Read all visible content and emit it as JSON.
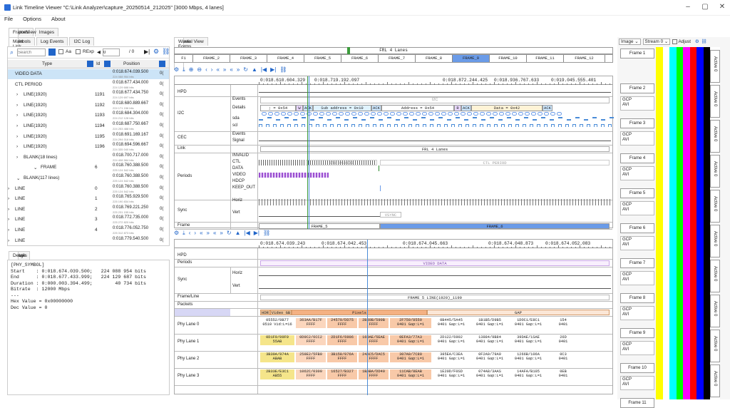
{
  "window": {
    "title": "Link Timeline Viewer \"C:\\Link Analyzer\\capture_20250514_212025\" [3000 Mbps, 4 lanes]",
    "minimize": "–",
    "maximize": "▢",
    "close": "✕"
  },
  "menu": [
    "File",
    "Options",
    "About"
  ],
  "top_tabs": [
    "FrameView",
    "Reports",
    "Images"
  ],
  "sub_tabs": [
    "Main Link Events",
    "Symbols",
    "Log Events",
    "I2C Log"
  ],
  "search": {
    "placeholder": "Search",
    "aa_label": "Aa",
    "rexp_label": "RExp",
    "index_value": "0",
    "index_total": "/ 0"
  },
  "table": {
    "headers": [
      "Type",
      "Id",
      "Position"
    ],
    "rows": [
      {
        "indent": 2,
        "type": "VIDEO DATA",
        "id": "",
        "pos": "0:018.674.039.500",
        "pos2": "224 088 954 bits",
        "ox": "0(",
        "sel": true
      },
      {
        "indent": 2,
        "type": "CTL PERIOD",
        "id": "",
        "pos": "0:018.677.434.000",
        "pos2": "224 129 688 bits",
        "ox": "0(",
        "sel": false
      },
      {
        "indent": 1,
        "type": "LINE(1920)",
        "id": "1191",
        "pos": "0:018.677.434.750",
        "pos2": "224 129 697 bits",
        "ox": "0(",
        "sel": false
      },
      {
        "indent": 1,
        "type": "LINE(1920)",
        "id": "1192",
        "pos": "0:018.680.889.667",
        "pos2": "224 171 156 bits",
        "ox": "0(",
        "sel": false
      },
      {
        "indent": 1,
        "type": "LINE(1920)",
        "id": "1193",
        "pos": "0:018.684.304.000",
        "pos2": "224 212 128 bits",
        "ox": "0(",
        "sel": false
      },
      {
        "indent": 1,
        "type": "LINE(1920)",
        "id": "1194",
        "pos": "0:018.687.750.667",
        "pos2": "224 253 488 bits",
        "ox": "0(",
        "sel": false
      },
      {
        "indent": 1,
        "type": "LINE(1920)",
        "id": "1195",
        "pos": "0:018.691.169.167",
        "pos2": "224 294 016 bits",
        "ox": "0(",
        "sel": false
      },
      {
        "indent": 1,
        "type": "LINE(1920)",
        "id": "1196",
        "pos": "0:018.694.596.667",
        "pos2": "224 335 040 bits",
        "ox": "0(",
        "sel": false
      },
      {
        "indent": 1,
        "type": "BLANK(18 lines)",
        "id": "",
        "pos": "0:018.700.717.000",
        "pos2": "224 408 584 bits",
        "ox": "0(",
        "sel": false
      },
      {
        "indent": 0,
        "type": "FRAME",
        "id": "6",
        "pos": "0:018.760.388.500",
        "pos2": "225 124 542 bits",
        "ox": "0(",
        "sel": false
      },
      {
        "indent": 1,
        "type": "BLANK(117 lines)",
        "id": "",
        "pos": "0:018.760.388.500",
        "pos2": "225 124 542 bits",
        "ox": "0(",
        "sel": false
      },
      {
        "indent": 2,
        "type": "LINE",
        "id": "0",
        "pos": "0:018.760.388.500",
        "pos2": "225 124 542 bits",
        "ox": "0(",
        "sel": false
      },
      {
        "indent": 2,
        "type": "LINE",
        "id": "1",
        "pos": "0:018.765.929.500",
        "pos2": "225 190 834 bits",
        "ox": "0(",
        "sel": false
      },
      {
        "indent": 2,
        "type": "LINE",
        "id": "2",
        "pos": "0:018.769.221.250",
        "pos2": "225 231 155 bits",
        "ox": "0(",
        "sel": false
      },
      {
        "indent": 2,
        "type": "LINE",
        "id": "3",
        "pos": "0:018.772.735.000",
        "pos2": "225 272 820 bits",
        "ox": "0(",
        "sel": false
      },
      {
        "indent": 2,
        "type": "LINE",
        "id": "4",
        "pos": "0:018.776.052.750",
        "pos2": "225 312 873 bits",
        "ox": "0(",
        "sel": false
      },
      {
        "indent": 2,
        "type": "LINE",
        "id": "",
        "pos": "0:018.779.540.500",
        "pos2": "",
        "ox": "0(",
        "sel": false
      }
    ]
  },
  "detail_tabs": [
    "Details",
    "Image"
  ],
  "details": "[PHY_SYMBOL]\nStart    : 0:018.674.039.500;   224 088 954 bits\nEnd      : 0:018.677.433.999;   224 129 687 bits\nDuration : 0:000.003.394.499;        40 734 bits\nBitrate  : 12000 Mbps\n---\nHex Value = 0x00000000\nDec Value = 0",
  "main_tabs": [
    "Wave Forms",
    "Spatial View"
  ],
  "frl_label": "FRL 4 Lanes",
  "frames": [
    "F1",
    "FRAME_2",
    "FRAME_3",
    "FRAME_4",
    "FRAME_5",
    "FRAME_6",
    "FRAME_7",
    "FRAME_8",
    "FRAME_9",
    "FRAME_10",
    "FRAME_11",
    "FRAME_12"
  ],
  "wf1": {
    "timestamps": [
      "0:018.610.604.329",
      "0:018.719.192.097",
      "0:018.872.244.425",
      "0:018.936.767.633",
      "0:019.045.555.401"
    ],
    "rows": [
      "HPD",
      "I2C",
      "CEC",
      "Link",
      "Periods",
      "Sync",
      "Frame"
    ],
    "subrows": [
      "Events",
      "Details",
      "sda",
      "scl",
      "Events",
      "Signal",
      "INVALID",
      "CTL",
      "DATA",
      "VIDEO",
      "HDCP",
      "KEEP_OUT",
      "Horiz",
      "Vert"
    ],
    "i2c_events": "I2C",
    "i2c_details": [
      "; = 0x54",
      "W",
      "ACK",
      "Sub address = 0x10",
      "ACK",
      "Address = 0x54",
      "R",
      "ACK",
      "Data = 0x42",
      "ACK"
    ],
    "link_label": "FRL 4 Lanes",
    "ctl_period_labels": [
      "CTL PERIOD",
      "CTL PERIOD"
    ],
    "vsync_label": "VSYNC",
    "frame_labels": [
      "FRAME_5",
      "FRAME_6"
    ]
  },
  "wf2": {
    "timestamps": [
      "0:018.674.039.243",
      "0:018.674.042.453",
      "0:018.674.045.663",
      "0:018.674.048.873",
      "0:018.674.052.083"
    ],
    "rows": [
      "HPD",
      "Periods",
      "Sync",
      "Frame/Line",
      "Packets",
      "Symbols",
      "Phy Lane 0",
      "Phy Lane 1",
      "Phy Lane 2",
      "Phy Lane 3"
    ],
    "subrows": [
      "Horiz",
      "Vert"
    ],
    "video_data": "VIDEO DATA",
    "frame_line": "FRAME 5 LINE(1920)_1190",
    "symbols": [
      "HDR",
      "Video GB",
      "Pixels",
      "GAP"
    ],
    "lanes": [
      [
        "05552/0B77\n0510 Vid:L=16",
        "363AA/B17F\nFFFF",
        "24570/DD75\nFFFF",
        "2B30B/590B\nFFFF",
        "2F759/8559\n0401 Gap:L=1",
        "0B445/5A45\n0401 Gap:L=1",
        "1B1B5/D9B5\n0401 Gap:L=1",
        "1DOC1/E8C1\n0401 Gap:L=1",
        "154\n0401"
      ],
      [
        "0D1F9/09F9\n55AB",
        "0D9C2/6CC2\nFFFF",
        "2D1F6/6906\nFFFF",
        "160AE/5EAE\nFFFF",
        "0EFA3/77A3\n0401 Gap:L=1",
        "2D122/6902\n0401 Gap:L=1",
        "13884/9B84\n0401 Gap:L=1",
        "39DAE/1SAE\n0401 Gap:L=1",
        "26D\n0401"
      ],
      [
        "3B30A/874A\nABAB",
        "258E2/5FB0\nFFFF",
        "3B158/076A\nFFFF",
        "24AC5/DAC5\nFFFF",
        "307A0/7C80\n0401 Gap:L=1",
        "385EA/C3EA\n0401 Gap:L=1",
        "0F2A9/79A9\n0401 Gap:L=1",
        "1266B/106A\n0401 Gap:L=1",
        "0C3\n0401"
      ],
      [
        "2B33E/E3C1\nAB55",
        "1062C/0300\nFFFF",
        "16527/B327\nFFFF",
        "1BABA/DD40\nFFFF",
        "11CAB/8EAB\n0401 Gap:L=1",
        "1E20D/F0SD\n0401 Gap:L=1",
        "074A8/3AAS\n0401 Gap:L=1",
        "14AFA/B105\n0401 Gap:L=1",
        "0EB\n0401"
      ]
    ]
  },
  "image_tools": {
    "image_select": "Image",
    "stream_select": "Stream 0",
    "adjust": "Adjust"
  },
  "frames_panel": [
    {
      "label": "Frame 1",
      "sub": []
    },
    {
      "label": "Frame 2",
      "sub": [
        "GCP",
        "AVI"
      ]
    },
    {
      "label": "Frame 3",
      "sub": [
        "GCP",
        "AVI"
      ]
    },
    {
      "label": "Frame 4",
      "sub": [
        "GCP",
        "AVI"
      ]
    },
    {
      "label": "Frame 5",
      "sub": [
        "GCP",
        "AVI"
      ]
    },
    {
      "label": "Frame 6",
      "sub": [
        "GCP",
        "AVI"
      ]
    },
    {
      "label": "Frame 7",
      "sub": [
        "GCP",
        "AVI"
      ]
    },
    {
      "label": "Frame 8",
      "sub": [
        "GCP",
        "AVI"
      ]
    },
    {
      "label": "Frame 9",
      "sub": [
        "GCP",
        "AVI"
      ]
    },
    {
      "label": "Frame 10",
      "sub": [
        "GCP",
        "AVI"
      ]
    },
    {
      "label": "Frame 11",
      "sub": []
    }
  ],
  "active_label": "Active 0",
  "colors": {
    "bars": [
      "#ffff00",
      "#ffffff",
      "#00ffff",
      "#00ff00",
      "#ff00ff",
      "#ff0000",
      "#0000ff",
      "#000000"
    ],
    "accent": "#2065c9",
    "selection": "#cce4f7"
  }
}
